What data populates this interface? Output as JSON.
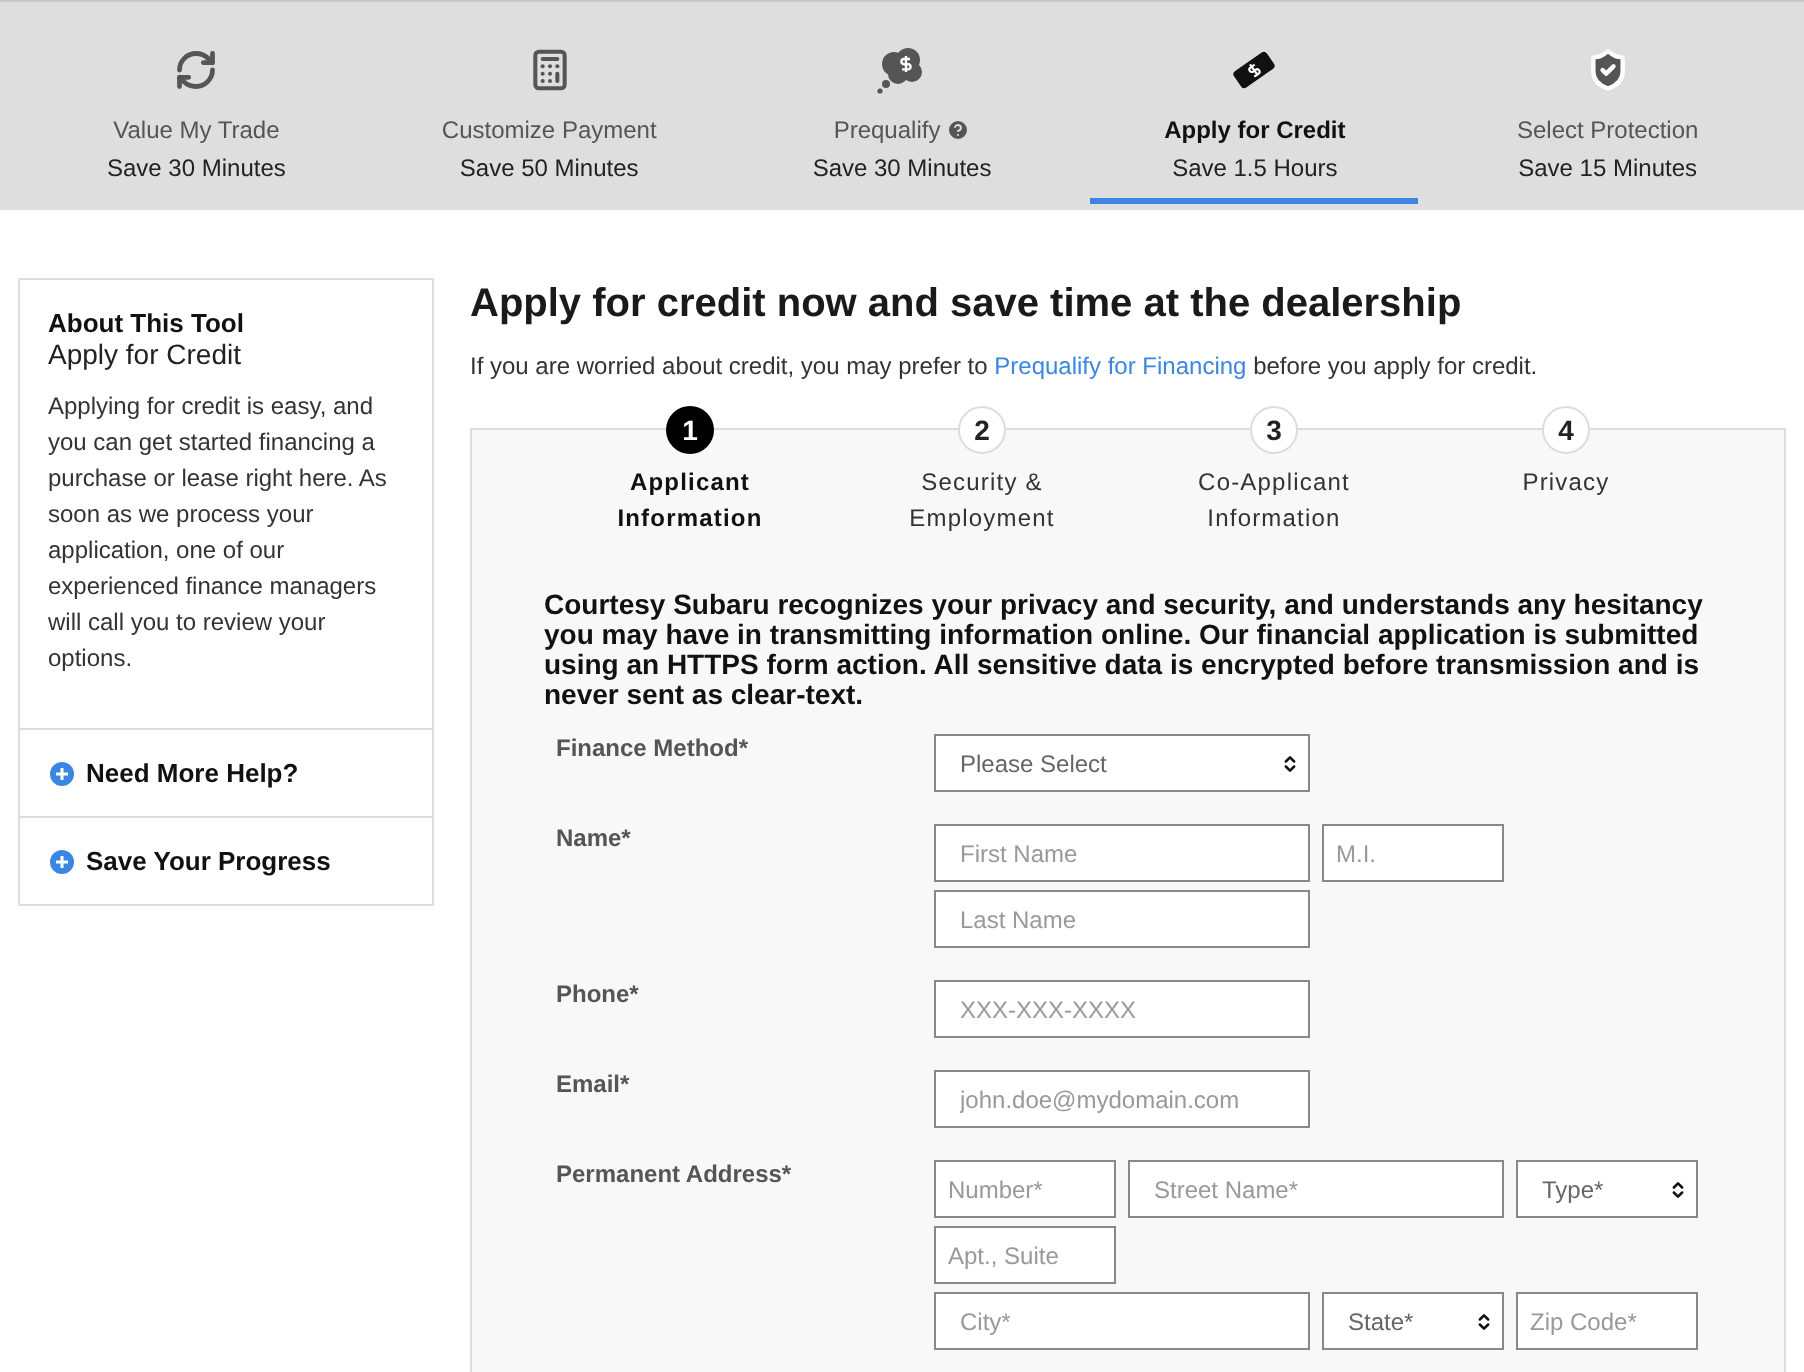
{
  "tools": [
    {
      "kind": "refresh",
      "label": "Value My Trade",
      "time": "Save 30 Minutes",
      "help": false,
      "selected": false
    },
    {
      "kind": "calculator",
      "label": "Customize Payment",
      "time": "Save 50 Minutes",
      "help": false,
      "selected": false
    },
    {
      "kind": "cloud",
      "label": "Prequalify",
      "time": "Save 30 Minutes",
      "help": true,
      "selected": false
    },
    {
      "kind": "ticket",
      "label": "Apply for Credit",
      "time": "Save 1.5 Hours",
      "help": false,
      "selected": true
    },
    {
      "kind": "shield",
      "label": "Select Protection",
      "time": "Save 15 Minutes",
      "help": false,
      "selected": false
    }
  ],
  "sidebar": {
    "heading": "About This Tool",
    "subheading": "Apply for Credit",
    "body": "Applying for credit is easy, and you can get started financing a purchase or lease right here. As soon as we process your application, one of our experienced finance managers will call you to review your options.",
    "sections": [
      {
        "label": "Need More Help?",
        "expanded": false
      },
      {
        "label": "Save Your Progress",
        "expanded": false
      }
    ]
  },
  "title": "Apply for credit now and save time at the dealership",
  "intro": {
    "before": "If you are worried about credit, you may prefer to",
    "link": "Prequalify for Financing",
    "after": "before you apply for credit."
  },
  "steps": [
    {
      "number": "1",
      "label": "Applicant Information",
      "selected": true
    },
    {
      "number": "2",
      "label": "Security & Employment",
      "selected": false
    },
    {
      "number": "3",
      "label": "Co-Applicant Information",
      "selected": false
    },
    {
      "number": "4",
      "label": "Privacy",
      "selected": false
    }
  ],
  "notice": "Courtesy Subaru recognizes your privacy and security, and understands any hesitancy you may have in transmitting information online. Our financial application is submitted using an HTTPS form action. All sensitive data is encrypted before transmission and is never sent as clear-text.",
  "form": [
    {
      "label": "Finance Method*",
      "lines": [
        [
          {
            "kind": "select",
            "wide": true,
            "placeholder": "Please Select"
          }
        ]
      ]
    },
    {
      "label": "Name*",
      "lines": [
        [
          {
            "kind": "input",
            "wide": true,
            "placeholder": "First Name"
          },
          {
            "kind": "input",
            "wide": false,
            "placeholder": "M.I."
          }
        ],
        [
          {
            "kind": "input",
            "wide": true,
            "placeholder": "Last Name"
          }
        ]
      ]
    },
    {
      "label": "Phone*",
      "lines": [
        [
          {
            "kind": "input",
            "wide": true,
            "placeholder": "XXX-XXX-XXXX"
          }
        ]
      ]
    },
    {
      "label": "Email*",
      "lines": [
        [
          {
            "kind": "input",
            "wide": true,
            "placeholder": "john.doe@mydomain.com"
          }
        ]
      ]
    },
    {
      "label": "Permanent Address*",
      "lines": [
        [
          {
            "kind": "input",
            "wide": false,
            "placeholder": "Number*"
          },
          {
            "kind": "input",
            "wide": true,
            "placeholder": "Street Name*"
          },
          {
            "kind": "select",
            "wide": false,
            "placeholder": "Type*"
          }
        ],
        [
          {
            "kind": "input",
            "wide": false,
            "placeholder": "Apt., Suite"
          }
        ],
        [
          {
            "kind": "input",
            "wide": true,
            "placeholder": "City*"
          },
          {
            "kind": "select",
            "wide": false,
            "placeholder": "State*"
          },
          {
            "kind": "input",
            "wide": false,
            "placeholder": "Zip Code*"
          }
        ]
      ]
    }
  ]
}
